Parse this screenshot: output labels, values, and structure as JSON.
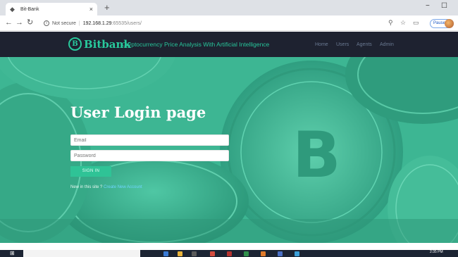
{
  "browser": {
    "tab_title": "Bit-Bank",
    "tab_close": "×",
    "new_tab": "+",
    "not_secure": "Not secure",
    "url_host": "192.168.1.29",
    "url_rest": ":65535/users/",
    "profile_status": "Paused",
    "window_minimize": "−",
    "window_maximize": "☐"
  },
  "site": {
    "logo_mark": "B",
    "logo_name": "Bitbank",
    "tagline": "Cryptocurrency Price Analysis With Artificial Intelligence",
    "nav": [
      "Home",
      "Users",
      "Agents",
      "Admin"
    ]
  },
  "login": {
    "title": "User Login page",
    "email_placeholder": "Email",
    "password_placeholder": "Password",
    "signin_label": "SIGN IN",
    "new_here_text": "New in this site ?",
    "create_account_link": "Create New Account"
  },
  "taskbar": {
    "time": "2:35 PM"
  },
  "colors": {
    "brand_green": "#28c99c",
    "nav_bg": "#1e2230",
    "hero_green": "#3fb796"
  },
  "icons": [
    "back-icon",
    "forward-icon",
    "reload-icon",
    "info-icon",
    "zoom-icon",
    "star-icon",
    "extension-icon",
    "windows-start-icon",
    "bitcoin-coin-icon"
  ]
}
